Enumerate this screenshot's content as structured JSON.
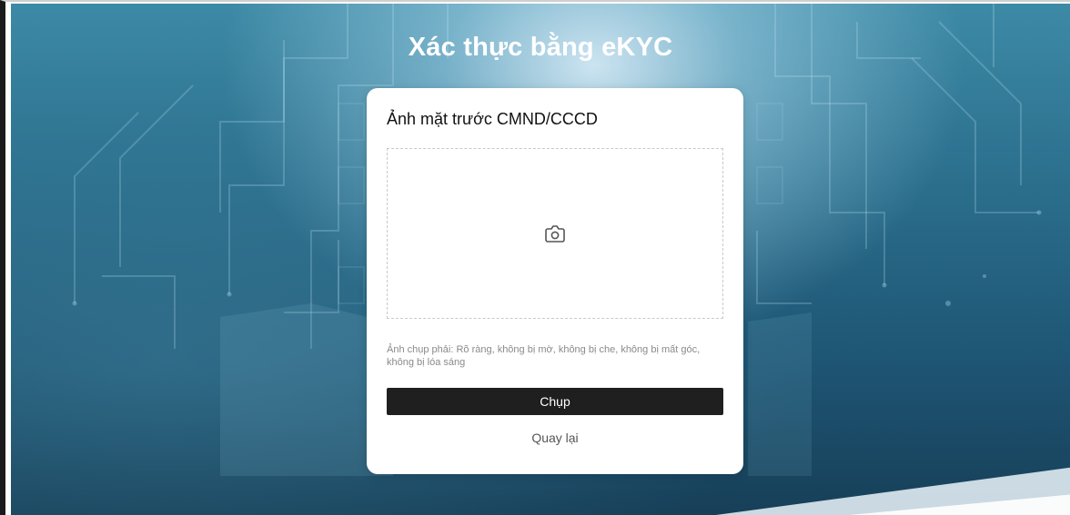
{
  "page": {
    "title": "Xác thực bằng eKYC"
  },
  "card": {
    "heading": "Ảnh mặt trước CMND/CCCD",
    "dropzone_icon": "camera-icon",
    "hint": "Ảnh chụp phải: Rõ ràng, không bị mờ, không bị che, không bị mất góc, không bị lóa sáng",
    "capture_label": "Chụp",
    "back_label": "Quay lại"
  },
  "colors": {
    "background_teal": "#2b6f8d",
    "card_bg": "#ffffff",
    "button_bg": "#1f1f1f",
    "hint_text": "#8a8a8a"
  }
}
